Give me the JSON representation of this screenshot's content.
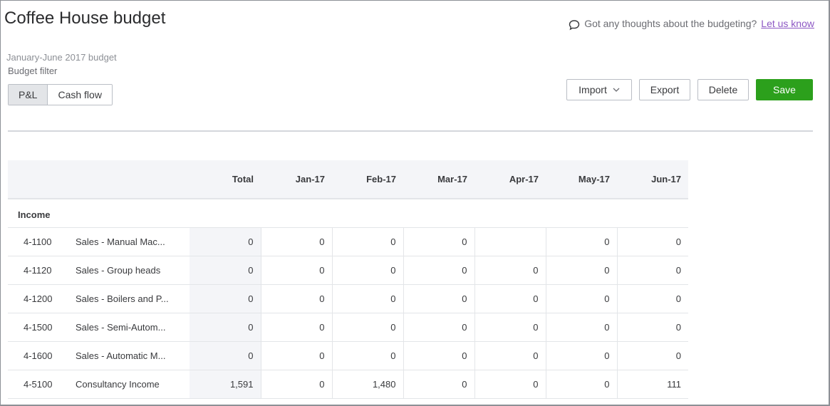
{
  "page": {
    "title": "Coffee House budget",
    "feedback_text": "Got any thoughts about the budgeting?",
    "feedback_link": "Let us know",
    "subtitle": "January-June 2017 budget",
    "filter_label": "Budget filter"
  },
  "filter_options": [
    "P&L",
    "Cash flow"
  ],
  "active_filter": "P&L",
  "actions": {
    "import": "Import",
    "export": "Export",
    "delete": "Delete",
    "save": "Save"
  },
  "colors": {
    "save_green": "#2ca01c",
    "link_purple": "#8d58c4",
    "header_bg": "#f4f5f8"
  },
  "table": {
    "columns": [
      "Total",
      "Jan-17",
      "Feb-17",
      "Mar-17",
      "Apr-17",
      "May-17",
      "Jun-17"
    ],
    "section": "Income",
    "rows": [
      {
        "code": "4-1100",
        "name": "Sales - Manual Mac...",
        "values": [
          "0",
          "0",
          "0",
          "0",
          "",
          "0",
          "0"
        ]
      },
      {
        "code": "4-1120",
        "name": "Sales - Group heads",
        "values": [
          "0",
          "0",
          "0",
          "0",
          "0",
          "0",
          "0"
        ]
      },
      {
        "code": "4-1200",
        "name": "Sales - Boilers and P...",
        "values": [
          "0",
          "0",
          "0",
          "0",
          "0",
          "0",
          "0"
        ]
      },
      {
        "code": "4-1500",
        "name": "Sales - Semi-Autom...",
        "values": [
          "0",
          "0",
          "0",
          "0",
          "0",
          "0",
          "0"
        ]
      },
      {
        "code": "4-1600",
        "name": "Sales - Automatic M...",
        "values": [
          "0",
          "0",
          "0",
          "0",
          "0",
          "0",
          "0"
        ]
      },
      {
        "code": "4-5100",
        "name": "Consultancy Income",
        "values": [
          "1,591",
          "0",
          "1,480",
          "0",
          "0",
          "0",
          "111"
        ]
      }
    ]
  }
}
